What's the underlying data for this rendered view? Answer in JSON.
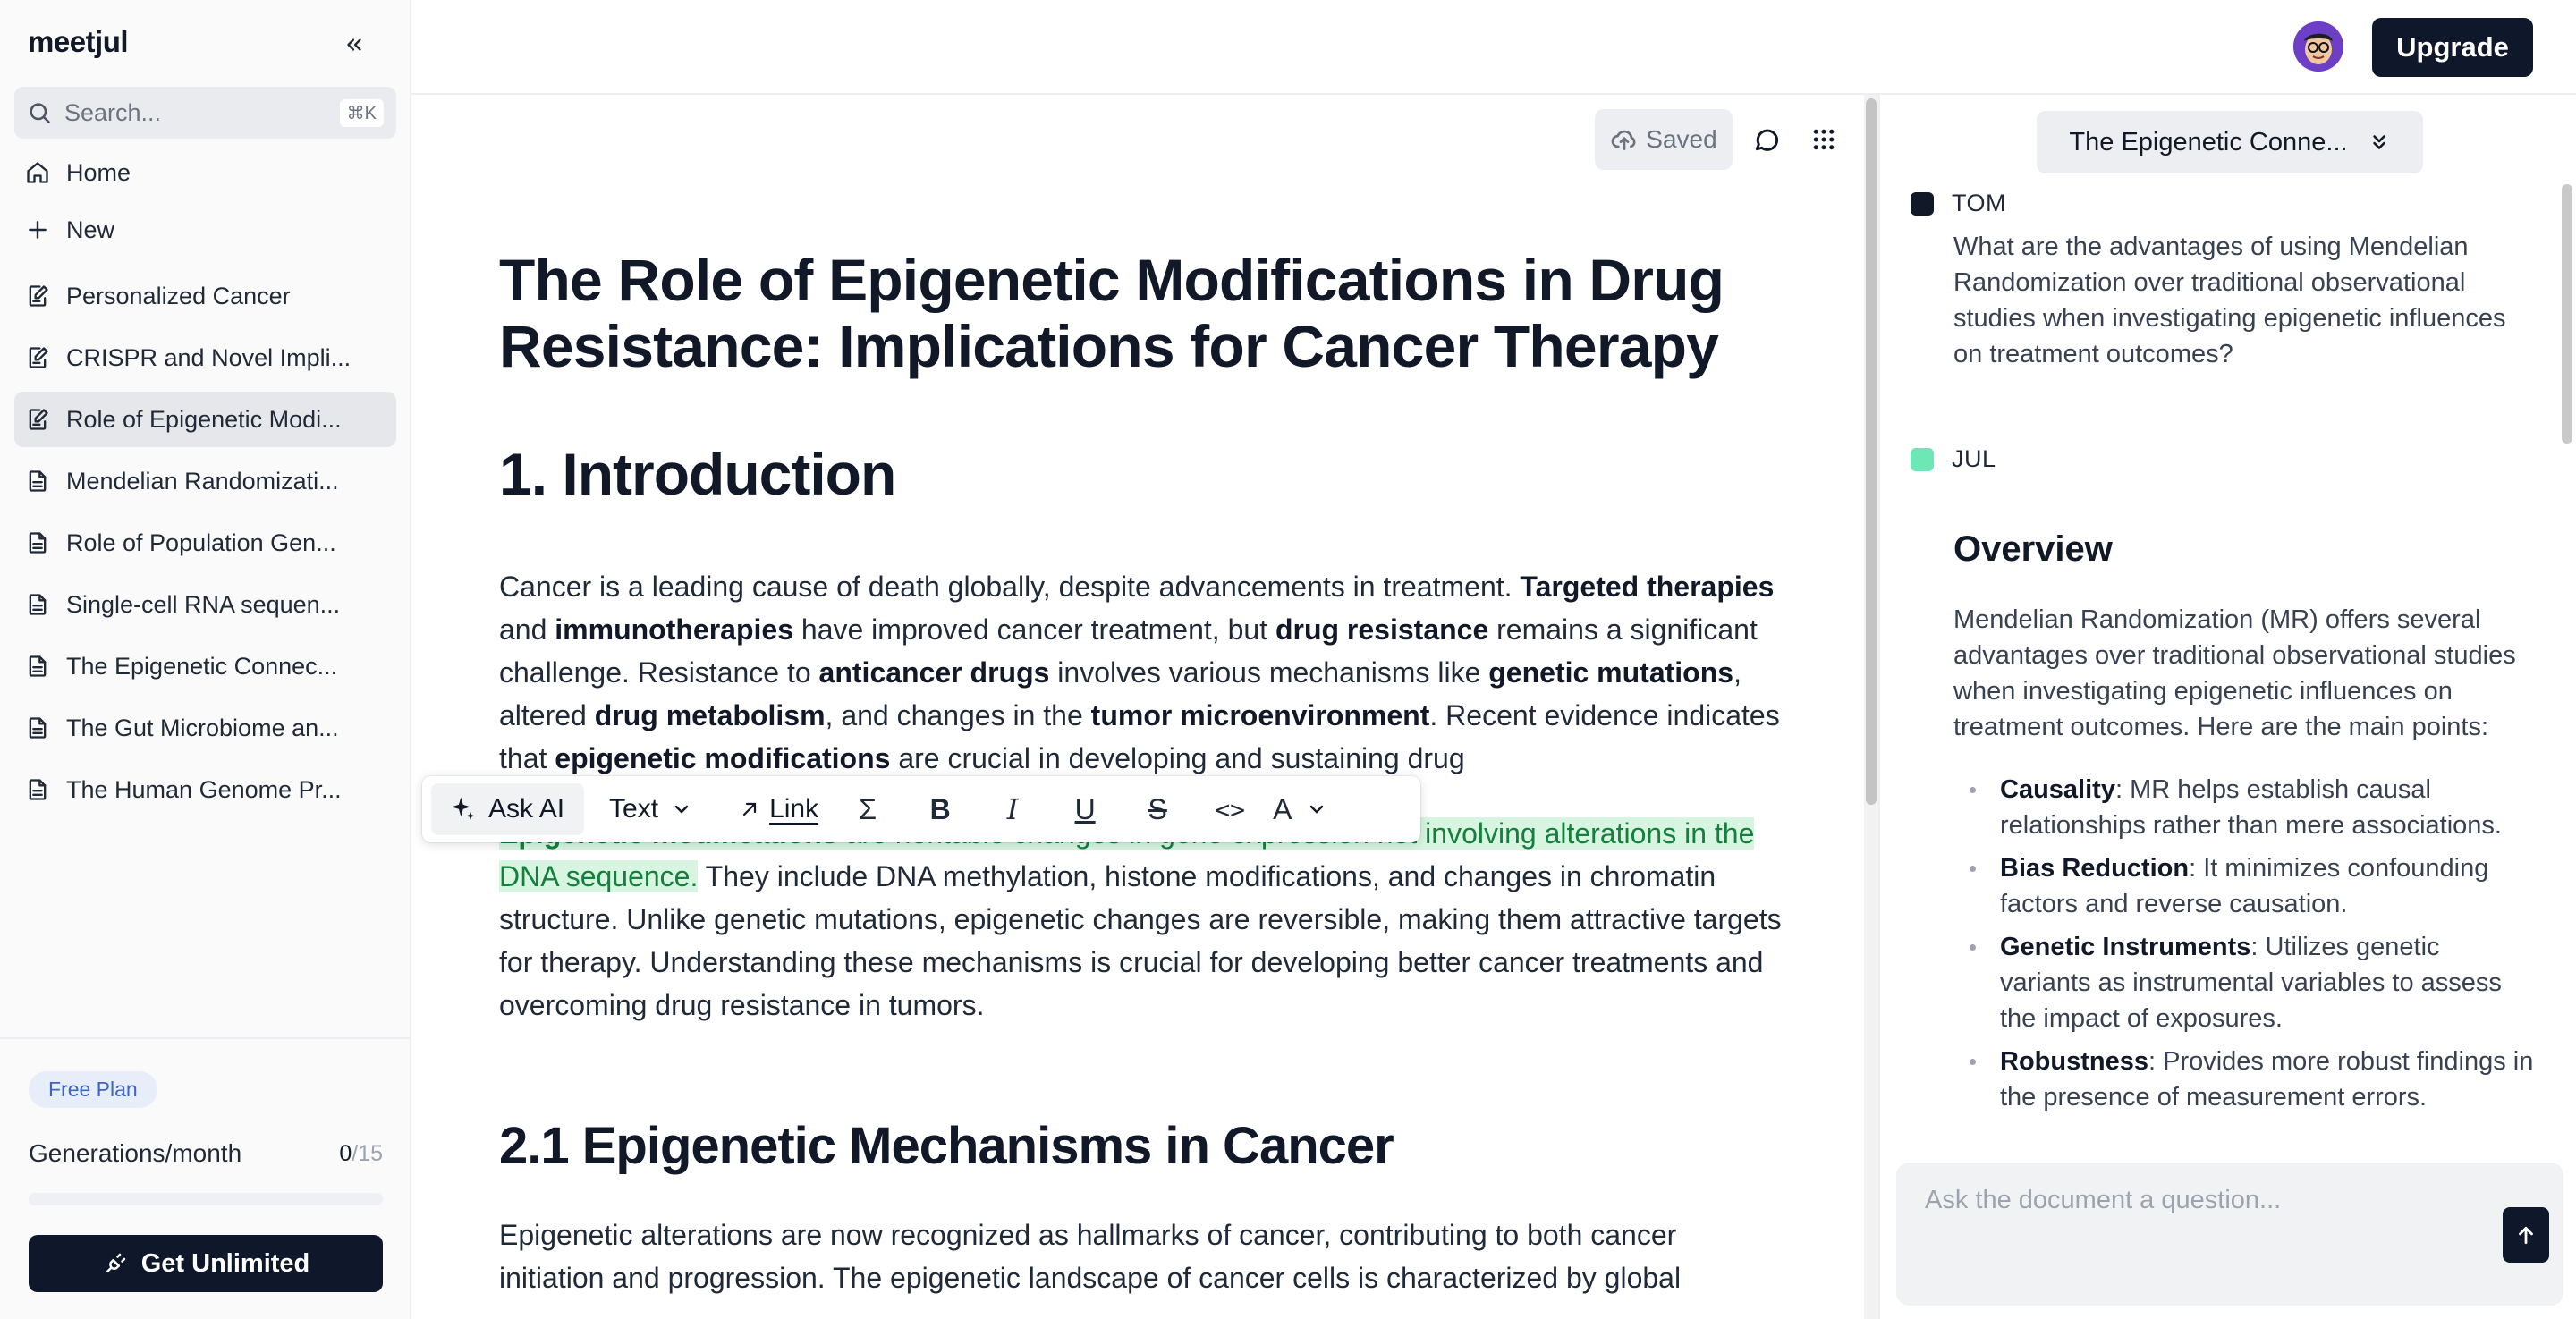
{
  "app": {
    "brand": "meetjul"
  },
  "sidebar": {
    "search_placeholder": "Search...",
    "search_shortcut": "⌘K",
    "home_label": "Home",
    "new_label": "New",
    "docs": [
      {
        "label": "Personalized Cancer",
        "icon": "edit-doc-icon"
      },
      {
        "label": "CRISPR and Novel Impli...",
        "icon": "edit-doc-icon"
      },
      {
        "label": "Role of Epigenetic Modi...",
        "icon": "edit-doc-icon",
        "active": true
      },
      {
        "label": "Mendelian Randomizati...",
        "icon": "doc-icon"
      },
      {
        "label": "Role of Population Gen...",
        "icon": "doc-icon"
      },
      {
        "label": "Single-cell RNA sequen...",
        "icon": "doc-icon"
      },
      {
        "label": "The Epigenetic Connec...",
        "icon": "doc-icon"
      },
      {
        "label": "The Gut Microbiome an...",
        "icon": "doc-icon"
      },
      {
        "label": "The Human Genome Pr...",
        "icon": "doc-icon"
      }
    ],
    "plan": {
      "badge": "Free Plan",
      "generations_label": "Generations/month",
      "used": "0",
      "limit": "/15",
      "usage_fraction": 0,
      "cta": "Get Unlimited"
    }
  },
  "header": {
    "upgrade_label": "Upgrade"
  },
  "editor": {
    "saved_label": "Saved",
    "title": "The Role of Epigenetic Modifications in Drug Resistance: Implications for Cancer Therapy",
    "intro_heading": "1. Introduction",
    "p1": {
      "s1": "Cancer is a leading cause of death globally, despite advancements in treatment. ",
      "b1": "Targeted therapies",
      "s2": " and ",
      "b2": "immunotherapies",
      "s3": " have improved cancer treatment, but ",
      "b3": "drug resistance",
      "s4": " remains a significant challenge. Resistance to ",
      "b4": "anticancer drugs",
      "s5": " involves various mechanisms like ",
      "b5": "genetic mutations",
      "s6": ", altered ",
      "b6": "drug metabolism",
      "s7": ", and changes in the ",
      "b7": "tumor microenvironment",
      "s8": ". Recent evidence indicates that ",
      "b8": "epigenetic modifications",
      "s9": " are crucial in developing and sustaining drug"
    },
    "p2": {
      "hl_bold": "Epigenetic modifications",
      "hl_rest": " are heritable changes in gene expression not involving alterations in the DNA sequence.",
      "rest": " They include DNA methylation, histone modifications, and changes in chromatin structure. Unlike genetic mutations, epigenetic changes are reversible, making them attractive targets for therapy. Understanding these mechanisms is crucial for developing better cancer treatments and overcoming drug resistance in tumors."
    },
    "mech_heading": "2.1 Epigenetic Mechanisms in Cancer",
    "p3": "Epigenetic alterations are now recognized as hallmarks of cancer, contributing to both cancer initiation and progression. The epigenetic landscape of cancer cells is characterized by global",
    "toolbar": {
      "ask_ai": "Ask AI",
      "text": "Text",
      "link": "Link",
      "sigma": "Σ",
      "bold": "B",
      "italic": "I",
      "underline": "U",
      "strike": "S",
      "code": "<>",
      "color": "A"
    }
  },
  "chat": {
    "doc_selector": "The Epigenetic Conne...",
    "user_name": "TOM",
    "user_color": "#111827",
    "question": "What are the advantages of using Mendelian Randomization over traditional observational studies when investigating epigenetic influences on treatment outcomes?",
    "bot_name": "JUL",
    "bot_color": "#6ee7b7",
    "answer_heading": "Overview",
    "answer_lead": "Mendelian Randomization (MR) offers several advantages over traditional observational studies when investigating epigenetic influences on treatment outcomes. Here are the main points:",
    "points": [
      {
        "term": "Causality",
        "text": ": MR helps establish causal relationships rather than mere associations."
      },
      {
        "term": "Bias Reduction",
        "text": ": It minimizes confounding factors and reverse causation."
      },
      {
        "term": "Genetic Instruments",
        "text": ": Utilizes genetic variants as instrumental variables to assess the impact of exposures."
      },
      {
        "term": "Robustness",
        "text": ": Provides more robust findings in the presence of measurement errors."
      }
    ],
    "input_placeholder": "Ask the document a question..."
  }
}
